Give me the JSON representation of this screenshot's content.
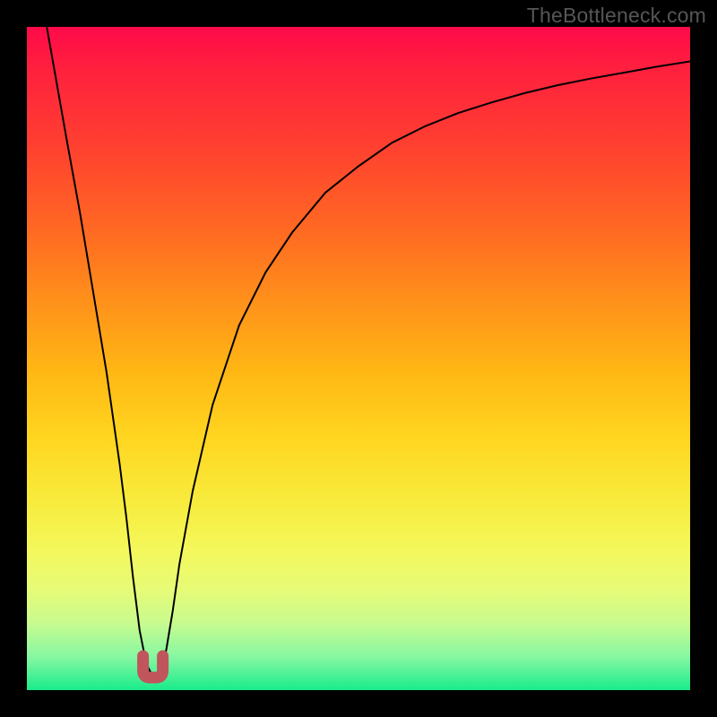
{
  "attribution": "TheBottleneck.com",
  "colors": {
    "marker_stroke": "#c1555c",
    "curve_stroke": "#000000",
    "frame_bg_top": "#ff0a4a",
    "frame_bg_bottom": "#19ec8c",
    "page_bg": "#000000"
  },
  "chart_data": {
    "type": "line",
    "title": "",
    "xlabel": "",
    "ylabel": "",
    "xlim": [
      0,
      100
    ],
    "ylim": [
      0,
      100
    ],
    "note": "Bottleneck-style cusp curve. y≈100 means maximum bottleneck (red, top); y≈0 means balanced (green, bottom). Minimum around x≈19.",
    "series": [
      {
        "name": "bottleneck-curve",
        "x": [
          3,
          6,
          8,
          10,
          12,
          14,
          15,
          16,
          17,
          18,
          19,
          20,
          21,
          22,
          23,
          25,
          28,
          32,
          36,
          40,
          45,
          50,
          55,
          60,
          65,
          70,
          75,
          80,
          85,
          90,
          95,
          100
        ],
        "values": [
          100,
          83,
          72,
          60,
          48,
          34,
          26,
          17,
          9,
          4,
          2,
          3,
          6,
          12,
          19,
          30,
          43,
          55,
          63,
          69,
          75,
          79,
          82.5,
          85,
          87,
          88.6,
          90,
          91.2,
          92.2,
          93.1,
          94,
          94.8
        ]
      }
    ],
    "marker": {
      "x": 19,
      "shape": "u",
      "color": "#c1555c"
    }
  }
}
